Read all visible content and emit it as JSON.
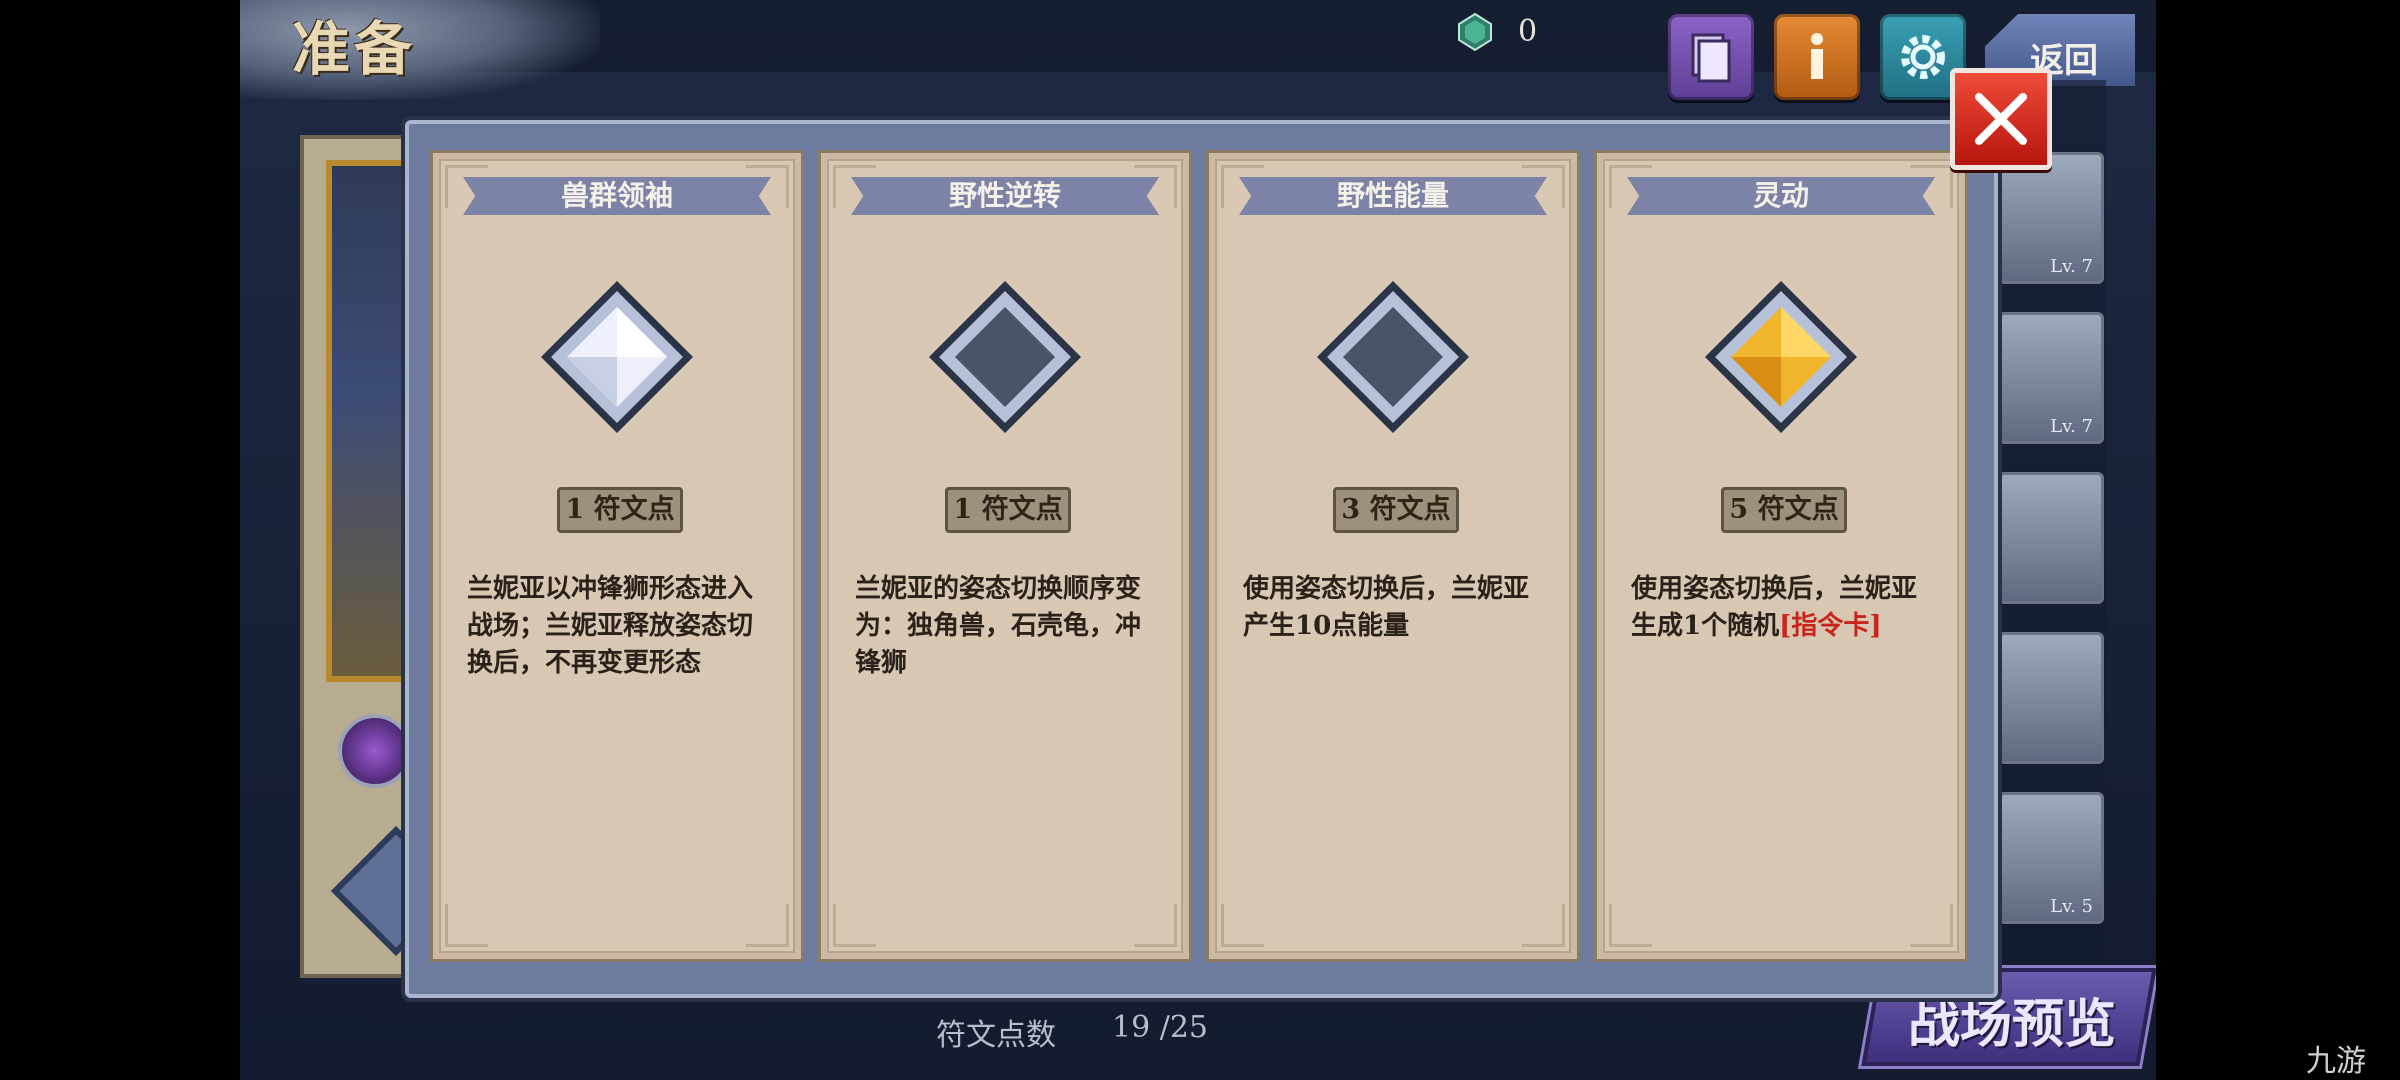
{
  "header": {
    "title": "准备",
    "currency_count": "0",
    "back_label": "返回"
  },
  "icons": {
    "currency": "green-crystal-icon",
    "book": "book-icon",
    "info": "info-icon",
    "settings": "gear-icon",
    "close": "close-icon"
  },
  "right_thumbs": [
    {
      "level": "Lv. 7"
    },
    {
      "level": "Lv. 7"
    },
    {
      "level": ""
    },
    {
      "level": ""
    },
    {
      "level": "Lv. 5"
    }
  ],
  "modal": {
    "cards": [
      {
        "title": "兽群领袖",
        "cost": "1 符文点",
        "desc": "兰妮亚以冲锋狮形态进入战场；兰妮亚释放姿态切换后，不再变更形态",
        "desc_highlight": "",
        "gem": "silver"
      },
      {
        "title": "野性逆转",
        "cost": "1 符文点",
        "desc": "兰妮亚的姿态切换顺序变为：独角兽，石壳龟，冲锋狮",
        "desc_highlight": "",
        "gem": "empty"
      },
      {
        "title": "野性能量",
        "cost": "3 符文点",
        "desc": "使用姿态切换后，兰妮亚产生10点能量",
        "desc_highlight": "",
        "gem": "empty"
      },
      {
        "title": "灵动",
        "cost": "5 符文点",
        "desc": "使用姿态切换后，兰妮亚生成1个随机",
        "desc_highlight": "[指令卡]",
        "gem": "gold"
      }
    ]
  },
  "footer": {
    "rune_points_label": "符文点数",
    "rune_points_value": "19 /25",
    "preview_label": "战场预览"
  },
  "watermark": "九游"
}
